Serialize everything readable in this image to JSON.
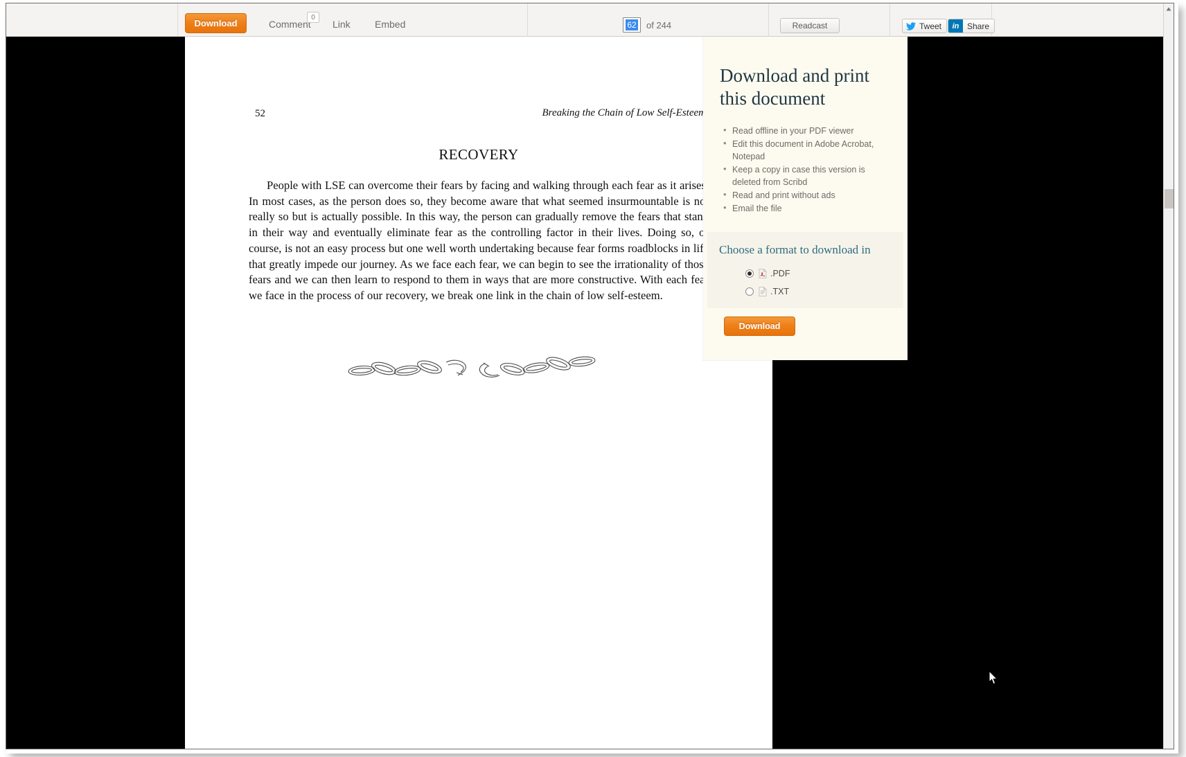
{
  "toolbar": {
    "download_label": "Download",
    "comment_label": "Comment",
    "comment_count": "0",
    "link_label": "Link",
    "embed_label": "Embed",
    "page_current": "62",
    "page_total": "of 244",
    "readcast_label": "Readcast",
    "tweet_label": "Tweet",
    "share_label": "Share",
    "linkedin_glyph": "in"
  },
  "document": {
    "folio": "52",
    "running_head": "Breaking the Chain of Low Self-Esteem",
    "heading": "RECOVERY",
    "body": "People with LSE can overcome their fears by facing and walking through each fear as it arises. In most cases, as the person does so, they become aware that what seemed insurmountable is not really so but is actually possible. In this way, the person can gradually remove the fears that stand in their way and eventually eliminate fear as the controlling factor in their lives. Doing so, of course, is not an easy process but one well worth undertaking because fear forms roadblocks in life that greatly impede our journey. As we face each fear, we can begin to see the irrationality of those fears and we can then learn to respond to them in ways that are more constructive. With each fear we face in the process of our recovery, we break one link in the chain of low self-esteem.",
    "figure_alt": "broken-chain-illustration"
  },
  "download_panel": {
    "title": "Download and print this document",
    "benefits": [
      "Read offline in your PDF viewer",
      "Edit this document in Adobe Acrobat, Notepad",
      "Keep a copy in case this version is deleted from Scribd",
      "Read and print without ads",
      "Email the file"
    ],
    "format_title": "Choose a format to download in",
    "formats": [
      {
        "label": ".PDF",
        "selected": true
      },
      {
        "label": ".TXT",
        "selected": false
      }
    ],
    "download_label": "Download"
  },
  "colors": {
    "accent_orange": "#ef7e17",
    "panel_cream": "#fdfbf0",
    "format_box": "#f6f4ea",
    "heading_navy": "#1f3642",
    "format_teal": "#2f6b80",
    "toolbar_bg": "#f4f3f1",
    "selection_blue": "#3a8bef",
    "linkedin_blue": "#0077b5",
    "twitter_blue": "#1da1f2"
  }
}
